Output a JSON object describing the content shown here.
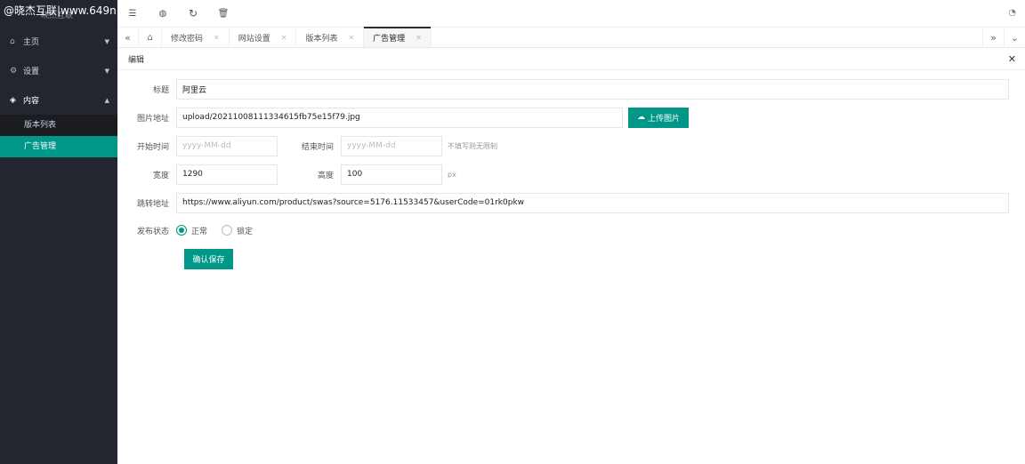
{
  "watermark": "@晓杰互联|www.649n",
  "watermark_ghost": "晓杰互联",
  "sidebar": {
    "items": [
      {
        "label": "主页",
        "icon": "home-icon",
        "glyph": "⌂"
      },
      {
        "label": "设置",
        "icon": "gear-icon",
        "glyph": "⚙"
      },
      {
        "label": "内容",
        "icon": "diamond-icon",
        "glyph": "◈"
      }
    ],
    "subitems": [
      {
        "label": "版本列表"
      },
      {
        "label": "广告管理"
      }
    ]
  },
  "topbar": {
    "icons": [
      "menu-icon",
      "globe-icon",
      "refresh-icon",
      "trash-icon"
    ],
    "right_icon": "theme-icon"
  },
  "tabs": [
    {
      "label": "修改密码"
    },
    {
      "label": "网站设置"
    },
    {
      "label": "版本列表"
    },
    {
      "label": "广告管理"
    }
  ],
  "panel": {
    "title": "编辑"
  },
  "form": {
    "title_label": "标题",
    "title_value": "阿里云",
    "image_label": "图片地址",
    "image_value": "upload/20211008111334615fb75e15f79.jpg",
    "upload_label": "上传图片",
    "start_label": "开始时间",
    "start_placeholder": "yyyy-MM-dd",
    "end_label": "结束时间",
    "end_placeholder": "yyyy-MM-dd",
    "time_hint": "不填写则无限制",
    "width_label": "宽度",
    "width_value": "1290",
    "height_label": "高度",
    "height_value": "100",
    "unit": "px",
    "url_label": "跳转地址",
    "url_value": "https://www.aliyun.com/product/swas?source=5176.11533457&userCode=01rk0pkw",
    "status_label": "发布状态",
    "status_options": [
      "正常",
      "锁定"
    ],
    "status_selected": 0,
    "save_label": "确认保存"
  }
}
